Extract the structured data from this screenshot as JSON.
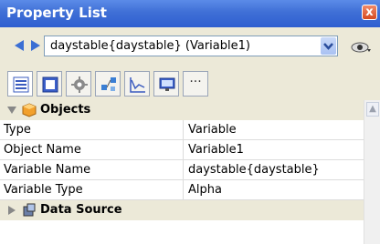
{
  "window": {
    "title": "Property List",
    "close_label": "x"
  },
  "selector": {
    "value": "daystable{daystable} (Variable1)"
  },
  "tabs": [
    {
      "icon": "list-icon"
    },
    {
      "icon": "panel-icon"
    },
    {
      "icon": "gear-icon"
    },
    {
      "icon": "network-icon"
    },
    {
      "icon": "chart-icon"
    },
    {
      "icon": "monitor-icon"
    },
    {
      "icon": "more-icon",
      "label": "···"
    }
  ],
  "sections": {
    "objects": {
      "label": "Objects"
    },
    "data_source": {
      "label": "Data Source"
    }
  },
  "properties": [
    {
      "key": "Type",
      "value": "Variable"
    },
    {
      "key": "Object Name",
      "value": "Variable1"
    },
    {
      "key": "Variable Name",
      "value": "daystable{daystable}"
    },
    {
      "key": "Variable Type",
      "value": "Alpha"
    }
  ]
}
